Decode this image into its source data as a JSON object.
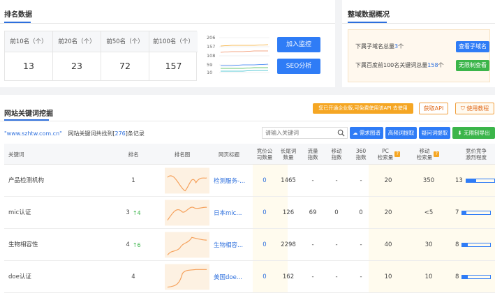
{
  "rank_panel": {
    "title": "排名数据",
    "columns": [
      {
        "label": "前10名（个）",
        "value": "13"
      },
      {
        "label": "前20名（个）",
        "value": "23"
      },
      {
        "label": "前50名（个）",
        "value": "72"
      },
      {
        "label": "前100名（个）",
        "value": "157"
      }
    ],
    "chart_ticks": [
      "206",
      "157",
      "108",
      "59",
      "10"
    ],
    "monitor_button": "加入监控",
    "seo_button": "SEO分析"
  },
  "overview_panel": {
    "title": "整域数据概况",
    "line1_prefix": "下属子域名总量",
    "line1_value": "3",
    "line1_suffix": "个",
    "line1_button": "查看子域名",
    "line2_prefix": "下属百度前100名关键词总量",
    "line2_value": "158",
    "line2_suffix": "个",
    "line2_button": "无限制查看"
  },
  "kw_panel": {
    "title": "网站关键词挖掘",
    "notice": "您已开通企业版,可免费使用该API 去使用",
    "get_api": "获取API",
    "tutorial": "使用教程",
    "domain": "\"www.szhtw.com.cn\"",
    "summary_mid": "网站关键词共找到[",
    "count": "276",
    "summary_end": "]条记录",
    "search_placeholder": "请输入关键词",
    "tools": [
      "需求图谱",
      "高频词提取",
      "疑问词提取",
      "无限制导出"
    ],
    "headers": {
      "keyword": "关键词",
      "rank": "排名",
      "trend": "排名图",
      "title": "网页标题",
      "bid": "竞价公\n司数量",
      "longtail": "长尾词\n数量",
      "traffic": "流量\n指数",
      "mobile_idx": "移动\n指数",
      "idx360": "360\n指数",
      "pc": "PC\n检索量",
      "mobile": "移动\n检索量",
      "competition": "竞价竞争\n激烈程度",
      "q": "?"
    },
    "rows": [
      {
        "keyword": "产品检测机构",
        "rank": "1",
        "change": "",
        "title": "检测服务-...",
        "bid": "0",
        "longtail": "1465",
        "traffic": "-",
        "mobile_idx": "-",
        "idx360": "-",
        "pc": "20",
        "mobile": "350",
        "competition": "13",
        "comp_level": 0.35
      },
      {
        "keyword": "mic认证",
        "rank": "3",
        "change": "4",
        "title": "日本mic...",
        "bid": "0",
        "longtail": "126",
        "traffic": "69",
        "mobile_idx": "0",
        "idx360": "0",
        "pc": "20",
        "mobile": "<5",
        "competition": "7",
        "comp_level": 0.15
      },
      {
        "keyword": "生物相容性",
        "rank": "4",
        "change": "6",
        "title": "生物相容...",
        "bid": "0",
        "longtail": "2298",
        "traffic": "-",
        "mobile_idx": "-",
        "idx360": "-",
        "pc": "40",
        "mobile": "30",
        "competition": "8",
        "comp_level": 0.18
      },
      {
        "keyword": "doe认证",
        "rank": "4",
        "change": "",
        "title": "美国doe...",
        "bid": "0",
        "longtail": "162",
        "traffic": "-",
        "mobile_idx": "-",
        "idx360": "-",
        "pc": "10",
        "mobile": "10",
        "competition": "8",
        "comp_level": 0.18
      }
    ]
  },
  "colors": {
    "accent": "#2f7cf6",
    "green": "#3bb54a",
    "orange": "#f5a623"
  },
  "icons": [
    "search-icon",
    "flame-icon",
    "shield-icon",
    "download-icon",
    "arrow-up-icon"
  ]
}
